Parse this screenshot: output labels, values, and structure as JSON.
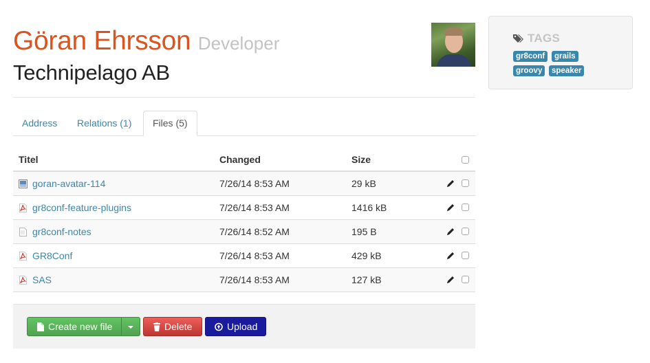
{
  "profile": {
    "name": "Göran Ehrsson",
    "role": "Developer",
    "company": "Technipelago AB"
  },
  "tabs": [
    {
      "label": "Address"
    },
    {
      "label": "Relations (1)"
    },
    {
      "label": "Files (5)",
      "active": true
    }
  ],
  "files_table": {
    "headers": {
      "title": "Titel",
      "changed": "Changed",
      "size": "Size"
    },
    "rows": [
      {
        "name": "goran-avatar-114",
        "icon": "image-file-icon",
        "changed": "7/26/14 8:53 AM",
        "size": "29 kB"
      },
      {
        "name": "gr8conf-feature-plugins",
        "icon": "pdf-file-icon",
        "changed": "7/26/14 8:53 AM",
        "size": "1416 kB"
      },
      {
        "name": "gr8conf-notes",
        "icon": "text-file-icon",
        "changed": "7/26/14 8:52 AM",
        "size": "195 B"
      },
      {
        "name": "GR8Conf",
        "icon": "pdf-file-icon",
        "changed": "7/26/14 8:53 AM",
        "size": "429 kB"
      },
      {
        "name": "SAS",
        "icon": "pdf-file-icon",
        "changed": "7/26/14 8:53 AM",
        "size": "127 kB"
      }
    ]
  },
  "actions": {
    "create_label": "Create new file",
    "delete_label": "Delete",
    "upload_label": "Upload"
  },
  "tags": {
    "heading": "TAGS",
    "items": [
      "gr8conf",
      "grails",
      "groovy",
      "speaker"
    ]
  },
  "colors": {
    "name": "#d9541e",
    "link": "#3a87ad",
    "tag": "#3a87ad",
    "create_button": "#5bb75b",
    "delete_button": "#da4f49",
    "upload_button": "#1a1a9c"
  }
}
